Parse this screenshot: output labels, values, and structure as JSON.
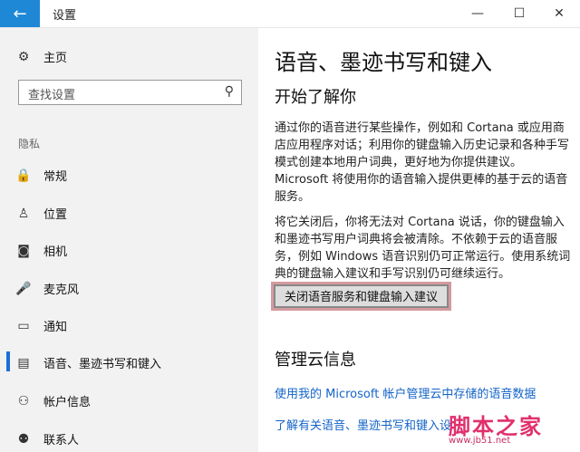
{
  "titlebar": {
    "title": "设置",
    "back_glyph": "←",
    "min_glyph": "—",
    "max_glyph": "☐",
    "close_glyph": "✕"
  },
  "sidebar": {
    "home": "主页",
    "search_placeholder": "查找设置",
    "section": "隐私",
    "items": [
      {
        "label": "常规",
        "icon": "lock-icon"
      },
      {
        "label": "位置",
        "icon": "location-icon"
      },
      {
        "label": "相机",
        "icon": "camera-icon"
      },
      {
        "label": "麦克风",
        "icon": "microphone-icon"
      },
      {
        "label": "通知",
        "icon": "notification-icon"
      },
      {
        "label": "语音、墨迹书写和键入",
        "icon": "document-icon"
      },
      {
        "label": "帐户信息",
        "icon": "account-icon"
      },
      {
        "label": "联系人",
        "icon": "contacts-icon"
      }
    ]
  },
  "main": {
    "title": "语音、墨迹书写和键入",
    "subtitle": "开始了解你",
    "para1": "通过你的语音进行某些操作，例如和 Cortana 或应用商店应用程序对话；利用你的键盘输入历史记录和各种手写模式创建本地用户词典，更好地为你提供建议。Microsoft 将使用你的语音输入提供更棒的基于云的语音服务。",
    "para2": "将它关闭后，你将无法对 Cortana 说话，你的键盘输入和墨迹书写用户词典将会被清除。不依赖于云的语音服务，例如 Windows 语音识别仍可正常运行。使用系统词典的键盘输入建议和手写识别仍可继续运行。",
    "button": "关闭语音服务和键盘输入建议",
    "section2": "管理云信息",
    "link1": "使用我的 Microsoft 帐户管理云中存储的语音数据",
    "link2": "了解有关语音、墨迹书写和键入设"
  },
  "watermark": {
    "text": "脚本之家",
    "url": "www.jb51.net"
  },
  "colors": {
    "accent": "#1e88d6",
    "link": "#1464c8",
    "highlight": "#d49aa0"
  }
}
